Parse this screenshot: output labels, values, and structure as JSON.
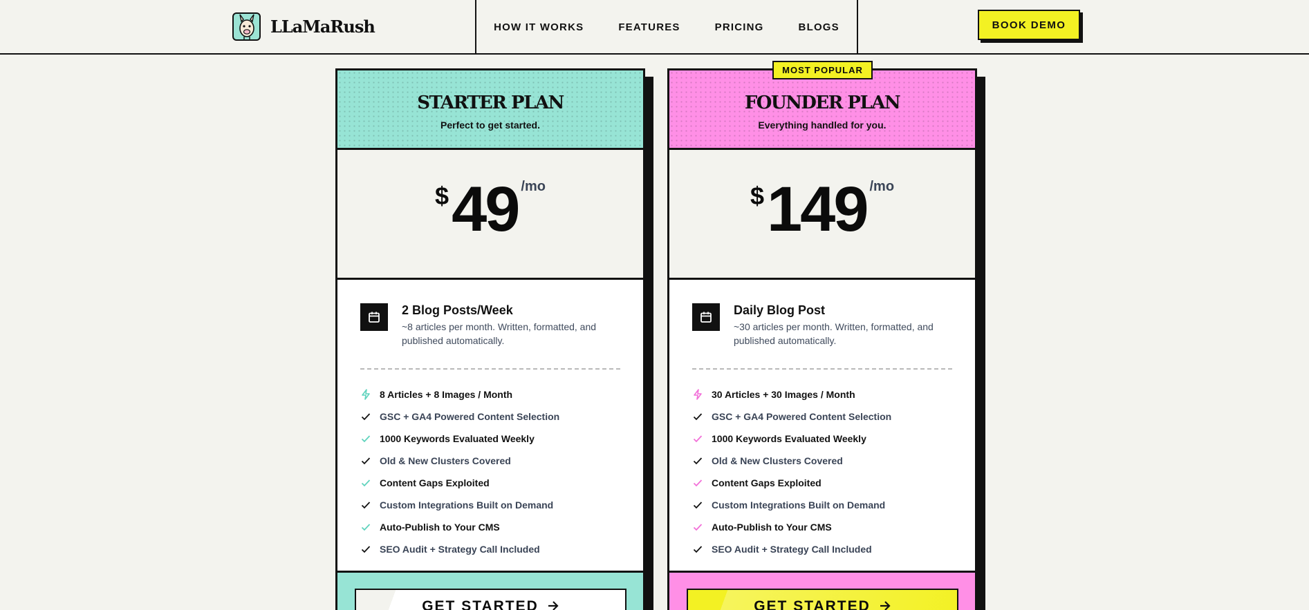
{
  "header": {
    "brand_name": "LLaMaRush",
    "nav": [
      "HOW IT WORKS",
      "FEATURES",
      "PRICING",
      "BLOGS"
    ],
    "cta_label": "BOOK DEMO"
  },
  "badge": {
    "label": "MOST POPULAR"
  },
  "plans": [
    {
      "title": "STARTER PLAN",
      "subtitle": "Perfect to get started.",
      "currency": "$",
      "amount": "49",
      "period": "/mo",
      "highlight_title": "2 Blog Posts/Week",
      "highlight_desc": "~8 articles per month. Written, formatted, and published automatically.",
      "features": [
        "8 Articles + 8 Images / Month",
        "GSC + GA4 Powered Content Selection",
        "1000 Keywords Evaluated Weekly",
        "Old & New Clusters Covered",
        "Content Gaps Exploited",
        "Custom Integrations Built on Demand",
        "Auto-Publish to Your CMS",
        "SEO Audit + Strategy Call Included"
      ],
      "cta": "GET STARTED",
      "accent": "#97e4d5"
    },
    {
      "title": "FOUNDER PLAN",
      "subtitle": "Everything handled for you.",
      "currency": "$",
      "amount": "149",
      "period": "/mo",
      "highlight_title": "Daily Blog Post",
      "highlight_desc": "~30 articles per month. Written, formatted, and published automatically.",
      "features": [
        "30 Articles + 30 Images / Month",
        "GSC + GA4 Powered Content Selection",
        "1000 Keywords Evaluated Weekly",
        "Old & New Clusters Covered",
        "Content Gaps Exploited",
        "Custom Integrations Built on Demand",
        "Auto-Publish to Your CMS",
        "SEO Audit + Strategy Call Included"
      ],
      "cta": "GET STARTED",
      "accent": "#ff8fe6"
    }
  ],
  "colors": {
    "background": "#f3f3ee",
    "yellow": "#f3f123",
    "teal": "#97e4d5",
    "pink": "#ff8fe6",
    "ink": "#111111"
  },
  "icons": {
    "logo": "llama-icon",
    "highlight": "calendar-icon",
    "first_feature": "lightning-icon",
    "feature": "check-icon",
    "cta": "arrow-right-icon"
  }
}
